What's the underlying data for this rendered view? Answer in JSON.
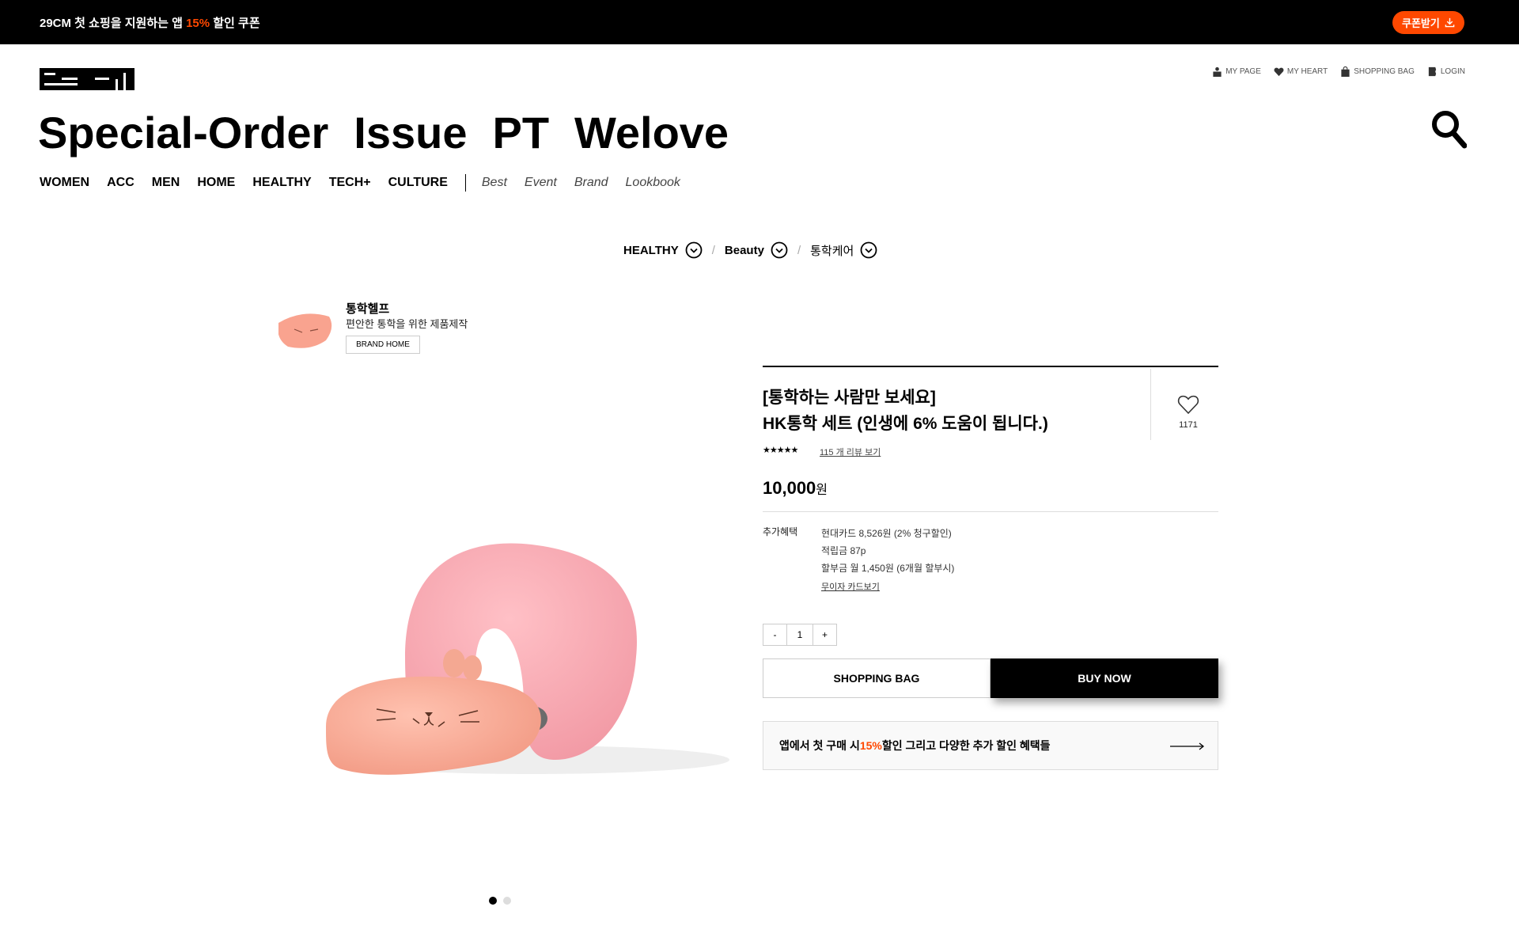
{
  "promo": {
    "prefix": "29CM 첫 쇼핑을 지원하는 앱 ",
    "highlight": "15%",
    "suffix": " 할인 쿠폰",
    "button_label": "쿠폰받기",
    "accent_color": "#ff4800"
  },
  "header": {
    "logo_icon": "29cm-logo",
    "util": [
      {
        "label": "MY PAGE",
        "icon": "person-icon"
      },
      {
        "label": "MY HEART",
        "icon": "heart-icon"
      },
      {
        "label": "SHOPPING BAG",
        "icon": "bag-icon"
      },
      {
        "label": "LOGIN",
        "icon": "login-icon"
      }
    ],
    "categories": [
      "Special-Order",
      "Issue",
      "PT",
      "Welove"
    ],
    "gnb_main": [
      "WOMEN",
      "ACC",
      "MEN",
      "HOME",
      "HEALTHY",
      "TECH+",
      "CULTURE"
    ],
    "gnb_sub": [
      "Best",
      "Event",
      "Brand",
      "Lookbook"
    ]
  },
  "breadcrumb": [
    {
      "label": "HEALTHY"
    },
    {
      "label": "Beauty"
    },
    {
      "label": "통학케어"
    }
  ],
  "brand": {
    "name": "통학헬프",
    "description": "편안한 통학을 위한 제품제작",
    "home_label": "BRAND HOME"
  },
  "product": {
    "title_line1": "[통학하는 사람만 보세요]",
    "title_line2": "HK통학 세트 (인생에 6% 도움이 됩니다.)",
    "heart_count": "1171",
    "rating_stars": "★★★★★",
    "rating_value": 4.8,
    "review_link": "115 개 리뷰 보기",
    "price": "10,000",
    "price_unit": "원",
    "benefit_label": "추가혜택",
    "benefits": [
      "현대카드 8,526원 (2% 청구할인)",
      "적립금 87p",
      "할부금 월 1,450원 (6개월 할부시)"
    ],
    "card_link": "무이자 카드보기",
    "quantity": {
      "minus": "-",
      "value": "1",
      "plus": "+"
    },
    "bag_label": "SHOPPING BAG",
    "buy_label": "BUY NOW",
    "image_slides": 2,
    "active_slide": 1
  },
  "app_banner": {
    "prefix": "앱에서 첫 구매 시 ",
    "highlight": "15%",
    "suffix": " 할인 그리고 다양한 추가 할인 혜택들"
  }
}
